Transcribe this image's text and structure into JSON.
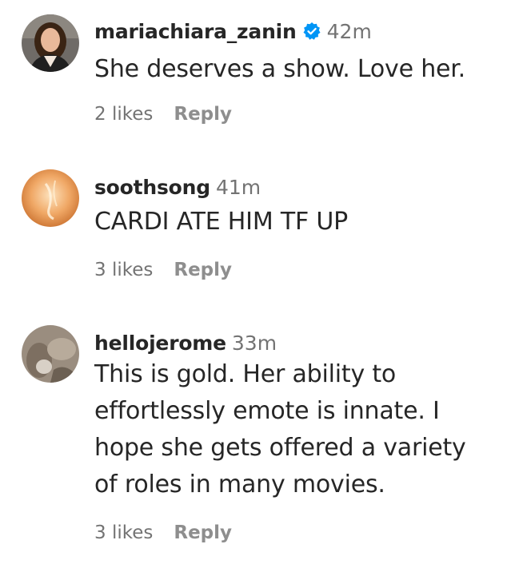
{
  "comments": [
    {
      "username": "mariachiara_zanin",
      "verified": true,
      "time": "42m",
      "text": "She deserves a show. Love her.",
      "likes": "2 likes",
      "reply": "Reply",
      "avatar": "profile-photo"
    },
    {
      "username": "soothsong",
      "verified": false,
      "time": "41m",
      "text": "CARDI ATE HIM TF UP",
      "likes": "3 likes",
      "reply": "Reply",
      "avatar": "profile-photo"
    },
    {
      "username": "hellojerome",
      "verified": false,
      "time": "33m",
      "text_lines": [
        "This is gold. Her ability to",
        "effortlessly emote is innate. I",
        "hope she gets offered a variety",
        "of roles in many movies."
      ],
      "likes": "3 likes",
      "reply": "Reply",
      "avatar": "profile-photo"
    }
  ],
  "icons": {
    "verified": "verified-badge-icon"
  },
  "colors": {
    "text": "#262626",
    "secondary": "#737373",
    "verified": "#0095f6"
  }
}
